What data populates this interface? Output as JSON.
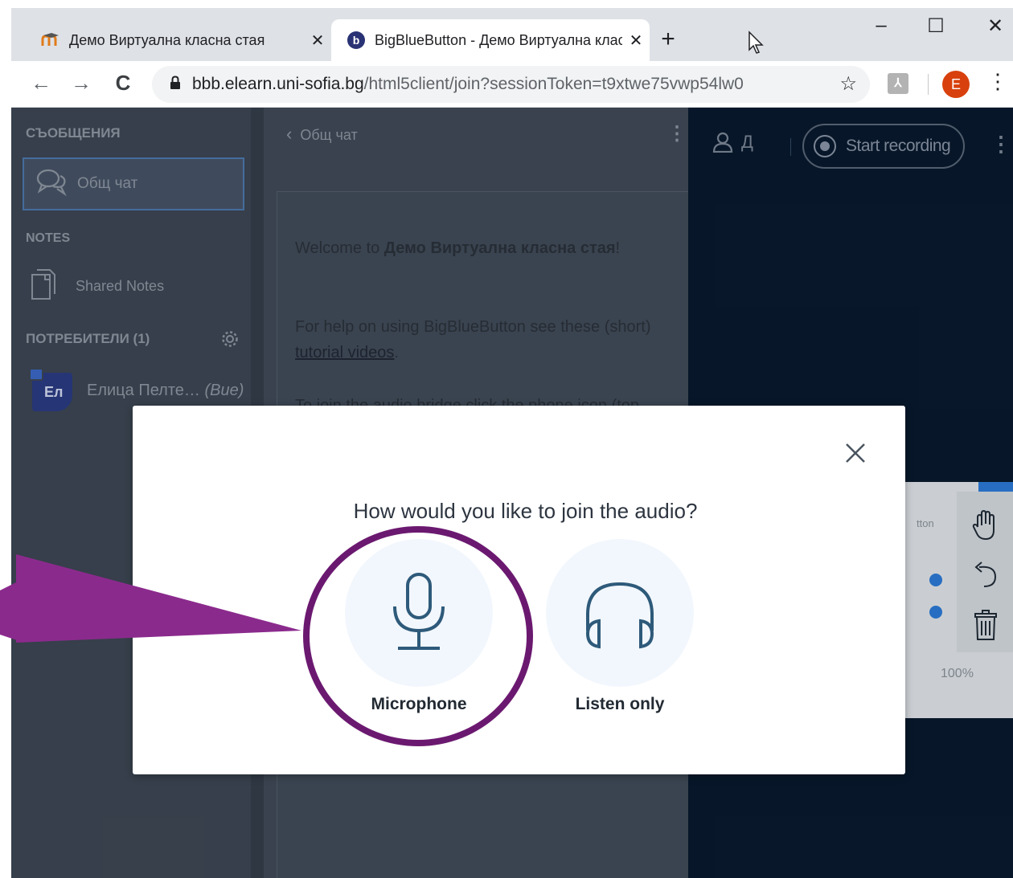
{
  "browser": {
    "tabs": [
      {
        "title": "Демо Виртуална класна стая",
        "close": "✕"
      },
      {
        "title": "BigBlueButton - Демо Виртуална класна стая",
        "close": "✕"
      }
    ],
    "new_tab": "+",
    "window_controls": {
      "minimize": "–",
      "maximize": "☐",
      "close": "✕"
    },
    "nav": {
      "back": "←",
      "forward": "→",
      "reload": "C"
    },
    "url_host": "bbb.elearn.uni-sofia.bg",
    "url_path": "/html5client/join?sessionToken=t9xtwe75vwp54lw0",
    "star": "☆",
    "profile_initial": "E",
    "menu": "⋮"
  },
  "sidebar": {
    "messages_title": "СЪОБЩЕНИЯ",
    "public_chat_label": "Общ чат",
    "notes_title": "NOTES",
    "shared_notes_label": "Shared Notes",
    "users_title": "ПОТРЕБИТЕЛИ (1)",
    "user": {
      "initials": "Ел",
      "name": "Елица Пелте…",
      "role": "(Вие)"
    }
  },
  "chat": {
    "header": "Общ чат",
    "back_glyph": "‹",
    "kebab": "⋮",
    "welcome_prefix": "Welcome to ",
    "welcome_room": "Демо Виртуална класна стая",
    "welcome_suffix": "!",
    "help_text": "For help on using BigBlueButton see these (short) ",
    "help_link": "tutorial videos",
    "help_end": ".",
    "audio_hint": "To join the audio bridge click the phone icon (top"
  },
  "main": {
    "user_label": "Д",
    "record_label": "Start recording",
    "kebab": "⋮",
    "thumb_title": "tton",
    "thumb_zoom": "100%"
  },
  "modal": {
    "title": "How would you like to join the audio?",
    "close": "×",
    "options": [
      {
        "label": "Microphone"
      },
      {
        "label": "Listen only"
      }
    ]
  },
  "colors": {
    "callout": "#8b2a8d",
    "ring": "#6b1970",
    "icon": "#2e5a7a"
  }
}
